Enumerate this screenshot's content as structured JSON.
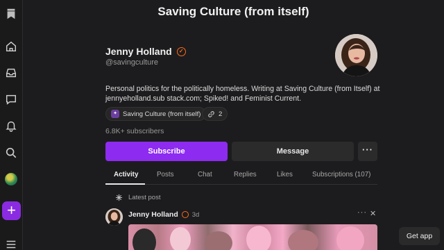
{
  "header": {
    "title": "Saving Culture (from itself)"
  },
  "profile": {
    "name": "Jenny Holland",
    "handle": "@savingculture",
    "bio": "Personal politics for the politically homeless. Writing at Saving Culture (from Itself) at jennyeholland.sub stack.com; Spiked! and Feminist Current.",
    "publication_pill": "Saving Culture (from itself)",
    "links_count": "2",
    "subscribers": "6.8K+ subscribers"
  },
  "actions": {
    "subscribe_label": "Subscribe",
    "message_label": "Message",
    "more_label": "···"
  },
  "tabs": [
    {
      "label": "Activity",
      "active": true
    },
    {
      "label": "Posts"
    },
    {
      "label": "Chat"
    },
    {
      "label": "Replies"
    },
    {
      "label": "Likes"
    },
    {
      "label": "Subscriptions (107)"
    }
  ],
  "feed": {
    "section_label": "Latest post",
    "post": {
      "author": "Jenny Holland",
      "time": "3d",
      "menu": "···",
      "close": "✕"
    }
  },
  "get_app_label": "Get app",
  "colors": {
    "accent": "#8d2bf0",
    "verified": "#ff6a1a",
    "background": "#1c1c1e"
  },
  "rail_icons": [
    "bookmark-logo-icon",
    "home-icon",
    "inbox-icon",
    "chat-icon",
    "bell-icon",
    "search-icon",
    "profile-avatar",
    "plus-icon",
    "menu-icon"
  ]
}
